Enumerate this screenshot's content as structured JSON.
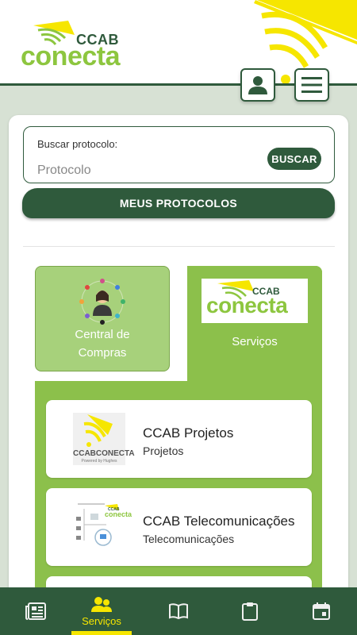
{
  "brand": {
    "name_top": "CCAB",
    "name_main": "conecta"
  },
  "header": {
    "user_icon": "user-icon",
    "menu_icon": "hamburger-menu-icon"
  },
  "search": {
    "label": "Buscar protocolo:",
    "placeholder": "Protocolo",
    "button_label": "BUSCAR"
  },
  "actions": {
    "meus_protocolos": "MEUS PROTOCOLOS"
  },
  "categories": [
    {
      "label_line1": "Central de",
      "label_line2": "Compras",
      "selected": false
    },
    {
      "label": "Serviços",
      "selected": true,
      "thumb_ccab": "CCAB",
      "thumb_conecta": "conecta"
    }
  ],
  "services": [
    {
      "title": "CCAB Projetos",
      "subtitle": "Projetos",
      "thumb_brand": "CCABCONECTA",
      "thumb_tagline": "Powered by Hughes"
    },
    {
      "title": "CCAB Telecomunicações",
      "subtitle": "Telecomunicações",
      "thumb_ccab": "CCAB",
      "thumb_conecta": "conecta"
    }
  ],
  "bottom_nav": {
    "items": [
      {
        "icon": "newspaper-icon",
        "label": ""
      },
      {
        "icon": "people-icon",
        "label": "Serviços",
        "active": true
      },
      {
        "icon": "book-icon",
        "label": ""
      },
      {
        "icon": "clipboard-icon",
        "label": ""
      },
      {
        "icon": "calendar-icon",
        "label": ""
      }
    ]
  },
  "colors": {
    "primary": "#2f5a3c",
    "accent_green": "#8cc04b",
    "light_green": "#a7d17b",
    "yellow": "#f6e600",
    "background": "#d7e1d4"
  }
}
